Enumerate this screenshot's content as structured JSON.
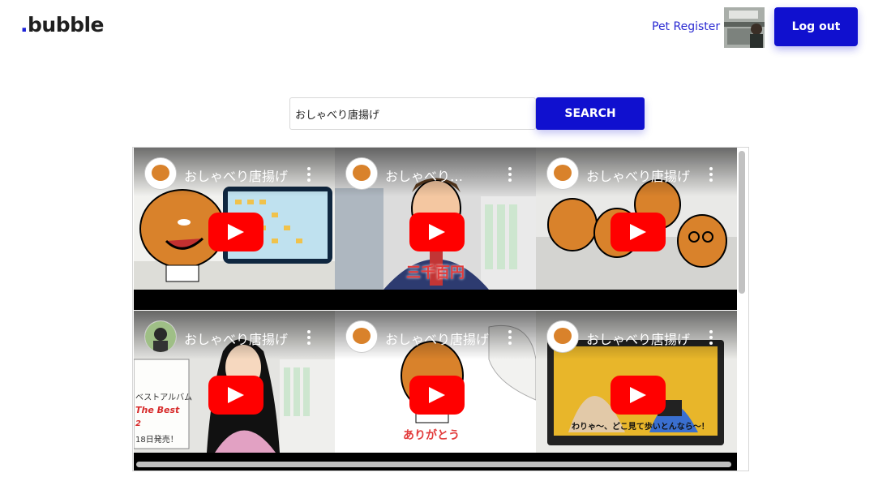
{
  "header": {
    "logo_dot": ".",
    "logo_text": "bubble",
    "nav_link": "Pet Register",
    "logout_label": "Log out"
  },
  "search": {
    "value": "おしゃべり唐揚げ",
    "button_label": "SEARCH"
  },
  "videos": [
    {
      "title": "おしゃべり唐揚げ",
      "play_icon": "play-icon"
    },
    {
      "title": "おしゃべり唐揚げ",
      "caption": "三千百円"
    },
    {
      "title": "おしゃべり唐揚げ"
    },
    {
      "title": "おしゃべり唐揚げ",
      "board_lines": [
        "ベストアルバム",
        "The Best",
        "2",
        "18日発売！"
      ]
    },
    {
      "title": "おしゃべり唐揚げ",
      "caption": "ありがとう"
    },
    {
      "title": "おしゃべり唐揚げ",
      "caption": "わりゃ〜、どこ見て歩いとんなら〜！"
    }
  ],
  "colors": {
    "brand_blue": "#1010cf",
    "youtube_red": "#ff0000"
  }
}
